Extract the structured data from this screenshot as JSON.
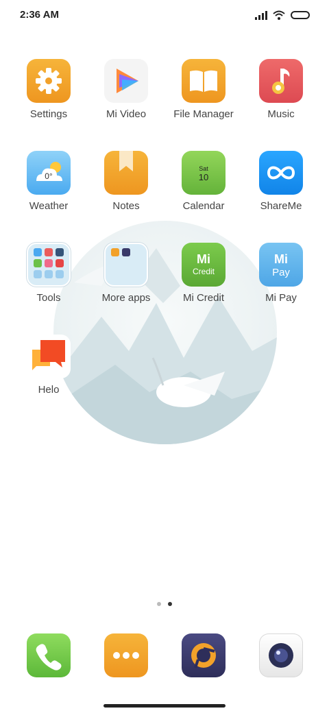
{
  "status_bar": {
    "time": "2:36 AM",
    "icons": [
      "signal-icon",
      "wifi-icon",
      "battery-icon"
    ]
  },
  "apps": [
    {
      "label": "Settings",
      "icon": "gear-icon",
      "color": "#f2a12a"
    },
    {
      "label": "Mi Video",
      "icon": "play-icon",
      "color": "#f4f4f4"
    },
    {
      "label": "File Manager",
      "icon": "book-icon",
      "color": "#f3a32c"
    },
    {
      "label": "Music",
      "icon": "music-note-icon",
      "color": "#e4525a"
    },
    {
      "label": "Weather",
      "icon": "cloud-sun-icon",
      "color": "#5cb8f0",
      "temp": "0°"
    },
    {
      "label": "Notes",
      "icon": "bookmark-icon",
      "color": "#f1a12d"
    },
    {
      "label": "Calendar",
      "icon": "calendar-icon",
      "color": "#7cc64a",
      "day": "Sat",
      "date": "10"
    },
    {
      "label": "ShareMe",
      "icon": "infinity-icon",
      "color": "#1d93f0"
    },
    {
      "label": "Tools",
      "icon": "folder-icon",
      "color": "#d9ecf6"
    },
    {
      "label": "More apps",
      "icon": "folder-icon",
      "color": "#d9ecf6"
    },
    {
      "label": "Mi Credit",
      "icon": "mi-credit-icon",
      "color": "#6ab93f",
      "badge_top": "Mi",
      "badge_bottom": "Credit"
    },
    {
      "label": "Mi Pay",
      "icon": "mi-pay-icon",
      "color": "#5fb2ea",
      "badge_top": "Mi",
      "badge_bottom": "Pay"
    },
    {
      "label": "Helo",
      "icon": "chat-bubbles-icon",
      "color": "#ff6a2a"
    }
  ],
  "pagination": {
    "pages": 2,
    "active": 2
  },
  "dock": [
    {
      "icon": "phone-icon",
      "color": "#6fc94a"
    },
    {
      "icon": "more-dots-icon",
      "color": "#f2a12a"
    },
    {
      "icon": "browser-icon",
      "color": "#3a3a6a"
    },
    {
      "icon": "camera-icon",
      "color": "#f2f2f2"
    }
  ]
}
